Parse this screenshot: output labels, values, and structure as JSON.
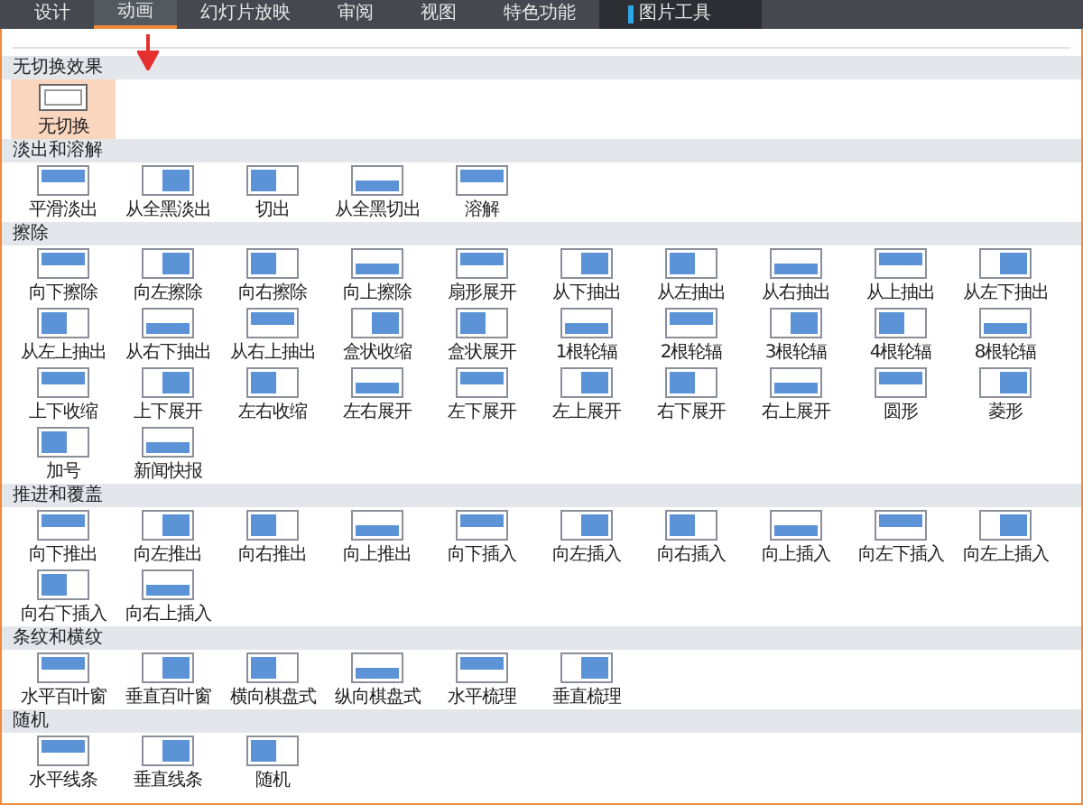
{
  "tabs": [
    {
      "label": "设计",
      "selected": false,
      "kind": "normal"
    },
    {
      "label": "动画",
      "selected": true,
      "kind": "normal"
    },
    {
      "label": "幻灯片放映",
      "selected": false,
      "kind": "normal"
    },
    {
      "label": "审阅",
      "selected": false,
      "kind": "normal"
    },
    {
      "label": "视图",
      "selected": false,
      "kind": "normal"
    },
    {
      "label": "特色功能",
      "selected": false,
      "kind": "normal"
    },
    {
      "label": "图片工具",
      "selected": false,
      "kind": "context"
    }
  ],
  "sections": [
    {
      "title": "无切换效果",
      "items": [
        {
          "label": "无切换",
          "selected": true
        }
      ]
    },
    {
      "title": "淡出和溶解",
      "items": [
        {
          "label": "平滑淡出",
          "selected": false
        },
        {
          "label": "从全黑淡出",
          "selected": false
        },
        {
          "label": "切出",
          "selected": false
        },
        {
          "label": "从全黑切出",
          "selected": false
        },
        {
          "label": "溶解",
          "selected": false
        }
      ]
    },
    {
      "title": "擦除",
      "items": [
        {
          "label": "向下擦除",
          "selected": false
        },
        {
          "label": "向左擦除",
          "selected": false
        },
        {
          "label": "向右擦除",
          "selected": false
        },
        {
          "label": "向上擦除",
          "selected": false
        },
        {
          "label": "扇形展开",
          "selected": false
        },
        {
          "label": "从下抽出",
          "selected": false
        },
        {
          "label": "从左抽出",
          "selected": false
        },
        {
          "label": "从右抽出",
          "selected": false
        },
        {
          "label": "从上抽出",
          "selected": false
        },
        {
          "label": "从左下抽出",
          "selected": false
        },
        {
          "label": "从左上抽出",
          "selected": false
        },
        {
          "label": "从右下抽出",
          "selected": false
        },
        {
          "label": "从右上抽出",
          "selected": false
        },
        {
          "label": "盒状收缩",
          "selected": false
        },
        {
          "label": "盒状展开",
          "selected": false
        },
        {
          "label": "1根轮辐",
          "selected": false
        },
        {
          "label": "2根轮辐",
          "selected": false
        },
        {
          "label": "3根轮辐",
          "selected": false
        },
        {
          "label": "4根轮辐",
          "selected": false
        },
        {
          "label": "8根轮辐",
          "selected": false
        },
        {
          "label": "上下收缩",
          "selected": false
        },
        {
          "label": "上下展开",
          "selected": false
        },
        {
          "label": "左右收缩",
          "selected": false
        },
        {
          "label": "左右展开",
          "selected": false
        },
        {
          "label": "左下展开",
          "selected": false
        },
        {
          "label": "左上展开",
          "selected": false
        },
        {
          "label": "右下展开",
          "selected": false
        },
        {
          "label": "右上展开",
          "selected": false
        },
        {
          "label": "圆形",
          "selected": false
        },
        {
          "label": "菱形",
          "selected": false
        },
        {
          "label": "加号",
          "selected": false
        },
        {
          "label": "新闻快报",
          "selected": false
        }
      ]
    },
    {
      "title": "推进和覆盖",
      "items": [
        {
          "label": "向下推出",
          "selected": false
        },
        {
          "label": "向左推出",
          "selected": false
        },
        {
          "label": "向右推出",
          "selected": false
        },
        {
          "label": "向上推出",
          "selected": false
        },
        {
          "label": "向下插入",
          "selected": false
        },
        {
          "label": "向左插入",
          "selected": false
        },
        {
          "label": "向右插入",
          "selected": false
        },
        {
          "label": "向上插入",
          "selected": false
        },
        {
          "label": "向左下插入",
          "selected": false
        },
        {
          "label": "向左上插入",
          "selected": false
        },
        {
          "label": "向右下插入",
          "selected": false
        },
        {
          "label": "向右上插入",
          "selected": false
        }
      ]
    },
    {
      "title": "条纹和横纹",
      "items": [
        {
          "label": "水平百叶窗",
          "selected": false
        },
        {
          "label": "垂直百叶窗",
          "selected": false
        },
        {
          "label": "横向棋盘式",
          "selected": false
        },
        {
          "label": "纵向棋盘式",
          "selected": false
        },
        {
          "label": "水平梳理",
          "selected": false
        },
        {
          "label": "垂直梳理",
          "selected": false
        }
      ]
    },
    {
      "title": "随机",
      "items": [
        {
          "label": "水平线条",
          "selected": false
        },
        {
          "label": "垂直线条",
          "selected": false
        },
        {
          "label": "随机",
          "selected": false
        }
      ]
    }
  ]
}
